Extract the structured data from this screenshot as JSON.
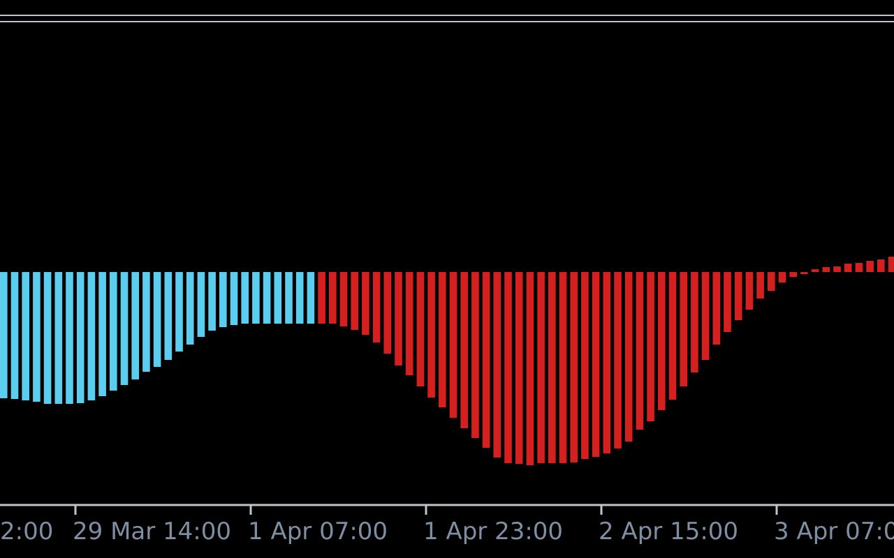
{
  "chart_data": {
    "type": "bar",
    "title": "",
    "xlabel": "",
    "ylabel": "",
    "grid": false,
    "x_tick_labels": [
      "2:00",
      "29 Mar 14:00",
      "1 Apr 07:00",
      "1 Apr 23:00",
      "2 Apr 15:00",
      "3 Apr 07:00"
    ],
    "series": [
      {
        "color": "#5bcdee",
        "values": [
          -181,
          -182,
          -184,
          -186,
          -189,
          -189,
          -189,
          -188,
          -184,
          -178,
          -170,
          -162,
          -154,
          -143,
          -136,
          -126,
          -114,
          -104,
          -93,
          -84,
          -79,
          -76,
          -74,
          -74,
          -74,
          -74,
          -74,
          -74,
          -74
        ]
      },
      {
        "color": "#d61f1f",
        "values": [
          -74,
          -74,
          -78,
          -83,
          -90,
          -101,
          -117,
          -134,
          -148,
          -164,
          -180,
          -194,
          -209,
          -224,
          -238,
          -252,
          -266,
          -274,
          -275,
          -277,
          -274,
          -274,
          -274,
          -273,
          -268,
          -265,
          -260,
          -253,
          -243,
          -226,
          -214,
          -198,
          -183,
          -164,
          -144,
          -126,
          -104,
          -86,
          -69,
          -54,
          -38,
          -27,
          -15,
          -7,
          -3,
          4,
          7,
          8,
          12,
          13,
          16,
          18,
          22,
          25,
          32
        ]
      }
    ]
  },
  "colors": {
    "background": "#000000",
    "axis": "#bfc5cc",
    "tick_text": "#7f8fa3"
  }
}
